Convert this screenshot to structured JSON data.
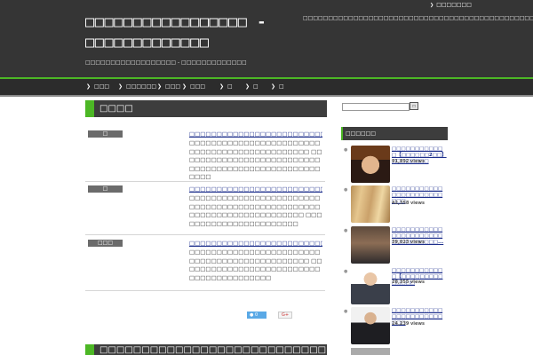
{
  "header": {
    "site_title": "□□□□□□□□□□□□□□□□□ - □□□□□□□□□□□□□",
    "site_description": "□□□□□□□□□□□□□□□□□□ - □□□□□□□□□□□□□",
    "tagline": "□□□□□□□□□□□□□□□□□□□□□□□□□□□□□□□□□□□□□□□□□□□□□□□□",
    "top_link": "□□□□□□□"
  },
  "nav": {
    "items": [
      {
        "label": "□□□"
      },
      {
        "label": "□□□□□□"
      },
      {
        "label": "□□□"
      },
      {
        "label": "□□□"
      },
      {
        "label": "□"
      },
      {
        "label": "□"
      },
      {
        "label": "□"
      }
    ]
  },
  "main": {
    "section_title": "□□□□",
    "posts": [
      {
        "category": "□",
        "title": "□□□□□□□□□□□□□□□□□□□□□□□□□□□□□□□□□□□",
        "excerpt": "□□□□□□□□□□□□□□□□□□□□□□□□□□□□□□□□□□□□□□□□□□□□□□ □□□□□□□□□□□□□□□□□□□□□□□□□□□□□□□□□□□□□□□□□□□□□□□□□□□□□□"
      },
      {
        "category": "□",
        "title": "□□□□□□□□□□□□□□□□□□□□□□□□□□□□□□□",
        "excerpt": "□□□□□□□□□□□□□□□□□□□□□□□□□□□□□□□□□□□□□□□□□□□□□□□□□□□□□□□□□□□□□□□□□□□□□ □□□□□□□□□□□□□□□□□□□□□□□"
      },
      {
        "category": "□□□",
        "title": "□□□□□□□□□□□□□□□□□□□□□□□□□□□□□□□",
        "excerpt": "□□□□□□□□□□□□□□□□□□□□□□□□□□□□□□□□□□□□□□□□□□□□□□ □□□□□□□□□□□□□□□□□□□□□□□□□□□□□□□□□□□□□□□□□"
      }
    ],
    "share_twitter": "0",
    "share_gplus": "G+",
    "bottom_section_title": "□□□□□□□□□□□□□□□□□□□□□□□□□□□□□□□□□"
  },
  "sidebar": {
    "search_placeholder": "",
    "search_button": "□",
    "widget_title": "□□□□□□",
    "popular": [
      {
        "title": "□□□□□□□□□□□□【□□□□□□2□□】□□□□□□□□",
        "views": "91,892 views",
        "thumb": "portrait-man-icon"
      },
      {
        "title": "□□□□□□□□□□□□□□□□□□□□□□□□□",
        "views": "42,358 views",
        "thumb": "hair-icon"
      },
      {
        "title": "□□□□□□□□□□□□□□□□□□□□□□□□□□□□□□□□...",
        "views": "39,023 views",
        "thumb": "fashion-icon"
      },
      {
        "title": "□□□□□□□□□□□□【□□□□□□□□□□□□□□",
        "views": "28,355 views",
        "thumb": "businessman-icon"
      },
      {
        "title": "□□□□□□□□□□□□□□□□□□□□□□□□□",
        "views": "24,239 views",
        "thumb": "suit-man-icon"
      }
    ]
  }
}
